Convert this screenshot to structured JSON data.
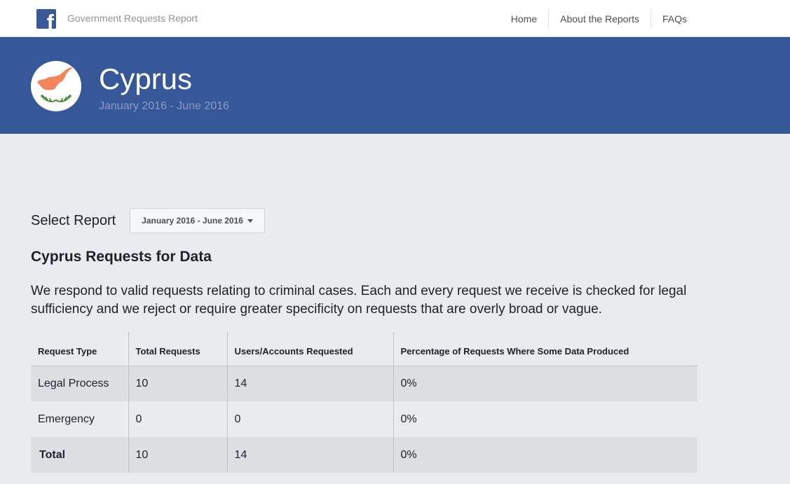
{
  "header": {
    "logo_letter": "f",
    "site_title": "Government Requests Report",
    "nav": [
      "Home",
      "About the Reports",
      "FAQs"
    ]
  },
  "hero": {
    "country": "Cyprus",
    "period": "January 2016 - June 2016",
    "flag_colors": {
      "land": "#f2865a",
      "wreath": "#4e8e3a"
    }
  },
  "report": {
    "select_label": "Select Report",
    "selected": "January 2016 - June 2016",
    "section_title": "Cyprus Requests for Data",
    "description": "We respond to valid requests relating to criminal cases. Each and every request we receive is checked for legal sufficiency and we reject or require greater specificity on requests that are overly broad or vague."
  },
  "table": {
    "headers": [
      "Request Type",
      "Total Requests",
      "Users/Accounts Requested",
      "Percentage of Requests Where Some Data Produced"
    ],
    "rows": [
      [
        "Legal Process",
        "10",
        "14",
        "0%"
      ],
      [
        "Emergency",
        "0",
        "0",
        "0%"
      ],
      [
        "Total",
        "10",
        "14",
        "0%"
      ]
    ]
  },
  "colors": {
    "brand": "#3b5998",
    "hero_bg": "#365899",
    "page_bg": "#e9ebee"
  }
}
